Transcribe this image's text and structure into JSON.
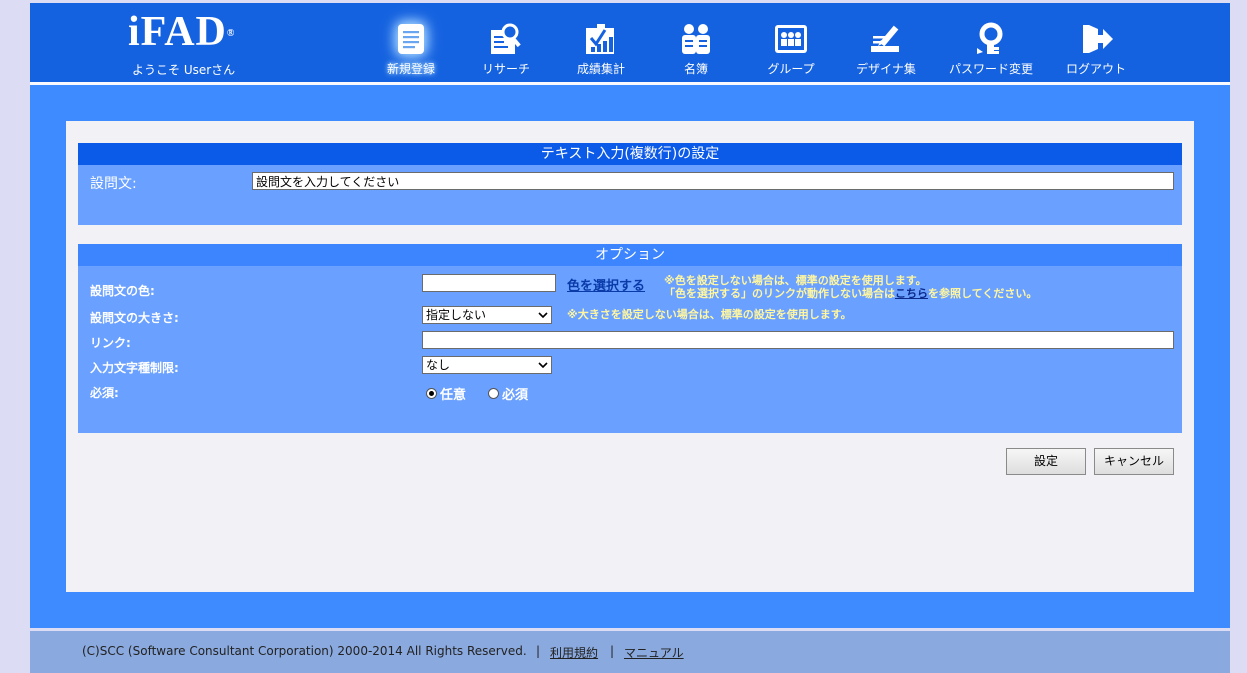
{
  "header": {
    "brand": "iFAD",
    "registered_mark": "®",
    "welcome": "ようこそ Userさん",
    "nav": [
      {
        "label": "新規登録",
        "icon": "new-document-icon"
      },
      {
        "label": "リサーチ",
        "icon": "research-icon"
      },
      {
        "label": "成績集計",
        "icon": "tally-icon"
      },
      {
        "label": "名簿",
        "icon": "roster-icon"
      },
      {
        "label": "グループ",
        "icon": "group-icon"
      },
      {
        "label": "デザイナ集",
        "icon": "designer-icon"
      },
      {
        "label": "パスワード変更",
        "icon": "password-key-icon"
      },
      {
        "label": "ログアウト",
        "icon": "logout-icon"
      }
    ]
  },
  "question_section": {
    "title": "テキスト入力(複数行)の設定",
    "question_label": "設問文:",
    "question_value": "設問文を入力してください"
  },
  "options_section": {
    "title": "オプション",
    "color_label": "設問文の色:",
    "color_value": "",
    "color_link": "色を選択する",
    "color_note_line1": "※色を設定しない場合は、標準の設定を使用します。",
    "color_note_line2_pre": "「色を選択する」のリンクが動作しない場合は",
    "color_note_line2_link": "こちら",
    "color_note_line2_post": "を参照してください。",
    "size_label": "設問文の大きさ:",
    "size_value": "指定しない",
    "size_note": "※大きさを設定しない場合は、標準の設定を使用します。",
    "link_label": "リンク:",
    "link_value": "",
    "charlimit_label": "入力文字種制限:",
    "charlimit_value": "なし",
    "required_label": "必須:",
    "radio_optional": "任意",
    "radio_required": "必須"
  },
  "buttons": {
    "ok": "設定",
    "cancel": "キャンセル"
  },
  "footer": {
    "copyright": "(C)SCC (Software Consultant Corporation) 2000-2014 All Rights Reserved.",
    "sep": "|",
    "terms": "利用規約",
    "manual": "マニュアル"
  },
  "colors": {
    "header_bg": "#1562e0",
    "content_bg": "#3d8bff",
    "section_head": "#0c5ae8",
    "section_body": "#6aa0ff",
    "footer_bg": "#8aa9de"
  }
}
